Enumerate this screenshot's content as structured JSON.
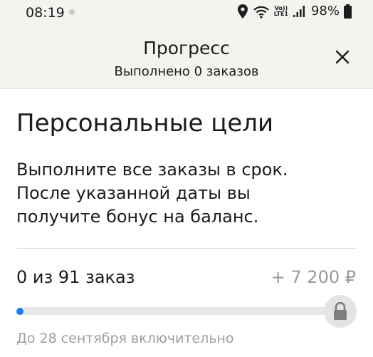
{
  "status_bar": {
    "time": "08:19",
    "volte_top": "Vo))",
    "volte_bottom": "LTE1",
    "battery": "98%",
    "icons": [
      "location-icon",
      "wifi-icon",
      "volte-icon",
      "signal-icon",
      "battery-icon"
    ]
  },
  "header": {
    "title": "Прогресс",
    "subtitle": "Выполнено 0 заказов",
    "close_icon": "close-icon"
  },
  "goal": {
    "heading": "Персональные цели",
    "description_lines": [
      "Выполните все заказы в срок.",
      "После указанной даты вы",
      "получите бонус на баланс."
    ],
    "progress_text": "0 из 91 заказ",
    "reward": "+ 7 200 ₽",
    "progress_fraction": 0,
    "lock_icon": "lock-icon",
    "deadline": "До 28 сентября включительно"
  },
  "colors": {
    "header_bg": "#f4f3f0",
    "accent": "#1d7ef2",
    "muted_text": "#9e9e9e",
    "track": "#e7e7e7"
  }
}
